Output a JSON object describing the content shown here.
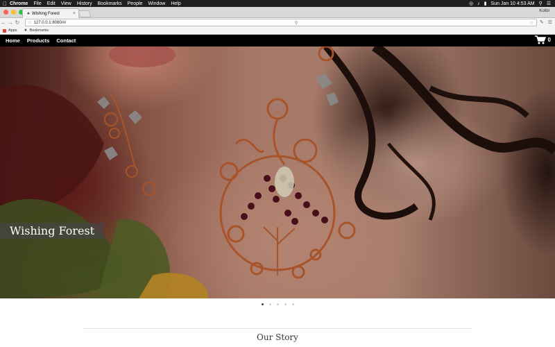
{
  "menubar": {
    "app": "Chrome",
    "menus": [
      "File",
      "Edit",
      "View",
      "History",
      "Bookmarks",
      "People",
      "Window",
      "Help"
    ],
    "clock": "Sun Jan 10  4:53 AM"
  },
  "browser": {
    "tab_title": "Wishing Forest",
    "profile": "Kolibi",
    "url": "127.0.0.1:8080/#/",
    "bookmarks": [
      "Apps",
      "Bookmarks"
    ]
  },
  "site_nav": {
    "links": [
      "Home",
      "Products",
      "Contact"
    ],
    "cart_count": "0"
  },
  "hero": {
    "caption": "Wishing Forest",
    "slide_count": 5,
    "active_slide": 0
  },
  "story": {
    "title": "Our Story"
  },
  "colors": {
    "navbar": "#000000",
    "caption_bg": "#464650",
    "copper": "#a8542a",
    "garnet": "#4a0e1a"
  }
}
